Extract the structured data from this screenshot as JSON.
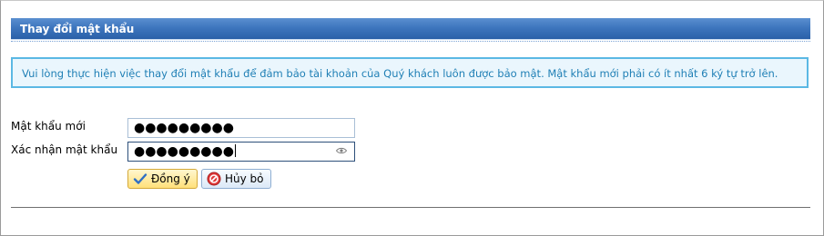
{
  "header": {
    "title": "Thay đổi mật khẩu"
  },
  "notice": {
    "text": "Vui lòng thực hiện việc thay đổi mật khẩu để đảm bảo tài khoản của Quý khách luôn được bảo mật. Mật khẩu mới phải có ít nhất 6 ký tự trở lên."
  },
  "form": {
    "new_password_label": "Mật khẩu mới",
    "new_password_value": "●●●●●●●●●",
    "confirm_password_label": "Xác nhận mật khẩu",
    "confirm_password_value": "●●●●●●●●●"
  },
  "buttons": {
    "ok_label": "Đồng ý",
    "cancel_label": "Hủy bỏ"
  },
  "colors": {
    "header_blue": "#3e76be",
    "notice_border": "#5bb8e4",
    "notice_text": "#1f7fb5"
  },
  "icons": {
    "ok": "checkmark-icon",
    "cancel": "cancel-icon",
    "reveal": "eye-icon"
  }
}
